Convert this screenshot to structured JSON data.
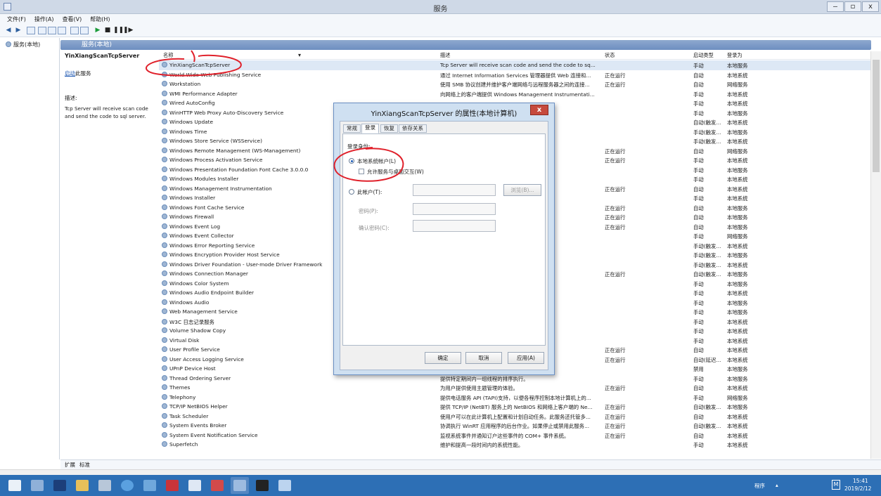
{
  "window": {
    "title": "服务",
    "controls": [
      "‒",
      "◻",
      "x"
    ]
  },
  "menu": [
    "文件(F)",
    "操作(A)",
    "查看(V)",
    "帮助(H)"
  ],
  "tree": {
    "root": "服务(本地)"
  },
  "header": {
    "title": "服务(本地)"
  },
  "detail": {
    "service_name": "YinXiangScanTcpServer",
    "start_link": "启动",
    "start_suffix": "此服务",
    "desc_label": "描述:",
    "desc_text": "Tcp Server will receive scan code and send the code to sql server."
  },
  "columns": {
    "name": "名称",
    "desc": "描述",
    "status": "状态",
    "startup": "启动类型",
    "logon": "登录为"
  },
  "services": [
    {
      "name": "YinXiangScanTcpServer",
      "desc": "Tcp Server will receive scan code and send the code to sq...",
      "status": "",
      "startup": "手动",
      "logon": "本地服务"
    },
    {
      "name": "World Wide Web Publishing Service",
      "desc": "通过 Internet Information Services 管理器提供 Web 连接和...",
      "status": "正在运行",
      "startup": "自动",
      "logon": "本地系统"
    },
    {
      "name": "Workstation",
      "desc": "使用 SMB 协议创建并维护客户端网络与远程服务器之间的连接...",
      "status": "正在运行",
      "startup": "自动",
      "logon": "网络服务"
    },
    {
      "name": "WMI Performance Adapter",
      "desc": "向网络上的客户端提供 Windows Management Instrumentati...",
      "status": "",
      "startup": "手动",
      "logon": "本地系统"
    },
    {
      "name": "Wired AutoConfig",
      "desc": "",
      "status": "",
      "startup": "手动",
      "logon": "本地系统"
    },
    {
      "name": "WinHTTP Web Proxy Auto-Discovery Service",
      "desc": "",
      "status": "",
      "startup": "手动",
      "logon": "本地服务"
    },
    {
      "name": "Windows Update",
      "desc": "",
      "status": "",
      "startup": "自动(触发...",
      "logon": "本地系统"
    },
    {
      "name": "Windows Time",
      "desc": "",
      "status": "",
      "startup": "手动(触发...",
      "logon": "本地服务"
    },
    {
      "name": "Windows Store Service (WSService)",
      "desc": "",
      "status": "",
      "startup": "手动(触发...",
      "logon": "本地系统"
    },
    {
      "name": "Windows Remote Management (WS-Management)",
      "desc": "",
      "status": "正在运行",
      "startup": "自动",
      "logon": "网络服务"
    },
    {
      "name": "Windows Process Activation Service",
      "desc": "",
      "status": "正在运行",
      "startup": "手动",
      "logon": "本地系统"
    },
    {
      "name": "Windows Presentation Foundation Font Cache 3.0.0.0",
      "desc": "",
      "status": "",
      "startup": "手动",
      "logon": "本地服务"
    },
    {
      "name": "Windows Modules Installer",
      "desc": "",
      "status": "",
      "startup": "手动",
      "logon": "本地系统"
    },
    {
      "name": "Windows Management Instrumentation",
      "desc": "",
      "status": "正在运行",
      "startup": "自动",
      "logon": "本地系统"
    },
    {
      "name": "Windows Installer",
      "desc": "",
      "status": "",
      "startup": "手动",
      "logon": "本地系统"
    },
    {
      "name": "Windows Font Cache Service",
      "desc": "",
      "status": "正在运行",
      "startup": "自动",
      "logon": "本地服务"
    },
    {
      "name": "Windows Firewall",
      "desc": "",
      "status": "正在运行",
      "startup": "自动",
      "logon": "本地服务"
    },
    {
      "name": "Windows Event Log",
      "desc": "",
      "status": "正在运行",
      "startup": "自动",
      "logon": "本地服务"
    },
    {
      "name": "Windows Event Collector",
      "desc": "",
      "status": "",
      "startup": "手动",
      "logon": "网络服务"
    },
    {
      "name": "Windows Error Reporting Service",
      "desc": "",
      "status": "",
      "startup": "手动(触发...",
      "logon": "本地系统"
    },
    {
      "name": "Windows Encryption Provider Host Service",
      "desc": "",
      "status": "",
      "startup": "手动(触发...",
      "logon": "本地服务"
    },
    {
      "name": "Windows Driver Foundation - User-mode Driver Framework",
      "desc": "",
      "status": "",
      "startup": "手动(触发...",
      "logon": "本地系统"
    },
    {
      "name": "Windows Connection Manager",
      "desc": "",
      "status": "正在运行",
      "startup": "自动(触发...",
      "logon": "本地服务"
    },
    {
      "name": "Windows Color System",
      "desc": "",
      "status": "",
      "startup": "手动",
      "logon": "本地服务"
    },
    {
      "name": "Windows Audio Endpoint Builder",
      "desc": "",
      "status": "",
      "startup": "手动",
      "logon": "本地系统"
    },
    {
      "name": "Windows Audio",
      "desc": "",
      "status": "",
      "startup": "手动",
      "logon": "本地服务"
    },
    {
      "name": "Web Management Service",
      "desc": "",
      "status": "",
      "startup": "手动",
      "logon": "本地服务"
    },
    {
      "name": "W3C 日志记录服务",
      "desc": "",
      "status": "",
      "startup": "手动",
      "logon": "本地系统"
    },
    {
      "name": "Volume Shadow Copy",
      "desc": "",
      "status": "",
      "startup": "手动",
      "logon": "本地系统"
    },
    {
      "name": "Virtual Disk",
      "desc": "",
      "status": "",
      "startup": "手动",
      "logon": "本地系统"
    },
    {
      "name": "User Profile Service",
      "desc": "",
      "status": "正在运行",
      "startup": "自动",
      "logon": "本地系统"
    },
    {
      "name": "User Access Logging Service",
      "desc": "",
      "status": "正在运行",
      "startup": "自动(延迟...",
      "logon": "本地系统"
    },
    {
      "name": "UPnP Device Host",
      "desc": "",
      "status": "",
      "startup": "禁用",
      "logon": "本地服务"
    },
    {
      "name": "Thread Ordering Server",
      "desc": "提供特定期间内一组线程的排序执行。",
      "status": "",
      "startup": "手动",
      "logon": "本地服务"
    },
    {
      "name": "Themes",
      "desc": "为用户提供使用主题管理的体验。",
      "status": "正在运行",
      "startup": "自动",
      "logon": "本地系统"
    },
    {
      "name": "Telephony",
      "desc": "提供电话服务 API (TAPI)支持，以便各程序控制本地计算机上的...",
      "status": "",
      "startup": "手动",
      "logon": "网络服务"
    },
    {
      "name": "TCP/IP NetBIOS Helper",
      "desc": "提供 TCP/IP (NetBT) 服务上的 NetBIOS 和网络上客户端的 Ne...",
      "status": "正在运行",
      "startup": "自动(触发...",
      "logon": "本地服务"
    },
    {
      "name": "Task Scheduler",
      "desc": "使用户可以在此计算机上配置和计划自动任务。此服务还托管多...",
      "status": "正在运行",
      "startup": "自动",
      "logon": "本地系统"
    },
    {
      "name": "System Events Broker",
      "desc": "协调执行 WinRT 应用程序的后台作业。如果停止或禁用此服务...",
      "status": "正在运行",
      "startup": "自动(触发...",
      "logon": "本地系统"
    },
    {
      "name": "System Event Notification Service",
      "desc": "监视系统事件并通知订户这些事件的 COM+ 事件系统。",
      "status": "正在运行",
      "startup": "自动",
      "logon": "本地系统"
    },
    {
      "name": "Superfetch",
      "desc": "维护和提高一段时间内的系统性能。",
      "status": "",
      "startup": "手动",
      "logon": "本地系统"
    }
  ],
  "bottom_tabs": [
    "扩展",
    "标准"
  ],
  "dialog": {
    "title": "YinXiangScanTcpServer 的属性(本地计算机)",
    "close": "x",
    "tabs": [
      "常规",
      "登录",
      "恢复",
      "依存关系"
    ],
    "logon_as": "登录身份:",
    "local_system": "本地系统帐户(L)",
    "allow_desktop": "允许服务与桌面交互(W)",
    "this_account": "此帐户(T):",
    "browse": "浏览(B)...",
    "password": "密码(P):",
    "confirm_password": "确认密码(C):",
    "ok": "确定",
    "cancel": "取消",
    "apply": "应用(A)"
  },
  "tray": {
    "label": "程序",
    "time": "15:41",
    "date": "2019/2/12"
  },
  "colors": {
    "taskbar": "#2d6fb5",
    "header": "#7a98c8",
    "annotation": "#e0202a"
  }
}
